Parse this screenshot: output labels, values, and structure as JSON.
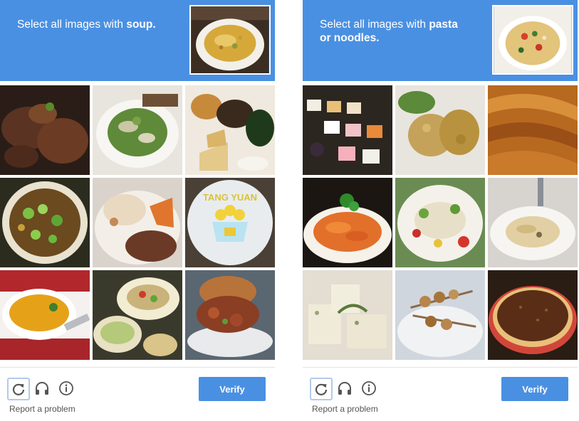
{
  "captchas": [
    {
      "instruction_prefix": "Select all images with ",
      "instruction_target": "soup.",
      "sample_image": "bowl of soup",
      "tiles": [
        "braised meat",
        "green salad",
        "platter with appetizers",
        "soup with green onions",
        "grilled fish plate",
        "tang yuan plate",
        "pumpkin soup",
        "dish with salad",
        "pulled pork burger"
      ],
      "report_label": "Report a problem",
      "verify_label": "Verify"
    },
    {
      "instruction_prefix": "Select all images with ",
      "instruction_target": "pasta or noodles.",
      "sample_image": "pasta salad",
      "tiles": [
        "cake display",
        "fried chicken",
        "woven fabric",
        "spaghetti",
        "salad plate",
        "fettuccine",
        "soap bars",
        "skewers",
        "chocolate tart"
      ],
      "report_label": "Report a problem",
      "verify_label": "Verify"
    }
  ],
  "icons": [
    "reload-icon",
    "headphones-icon",
    "info-icon"
  ],
  "colors": {
    "accent": "#4a90e2",
    "header_text": "#ffffff",
    "muted_text": "#555555"
  }
}
